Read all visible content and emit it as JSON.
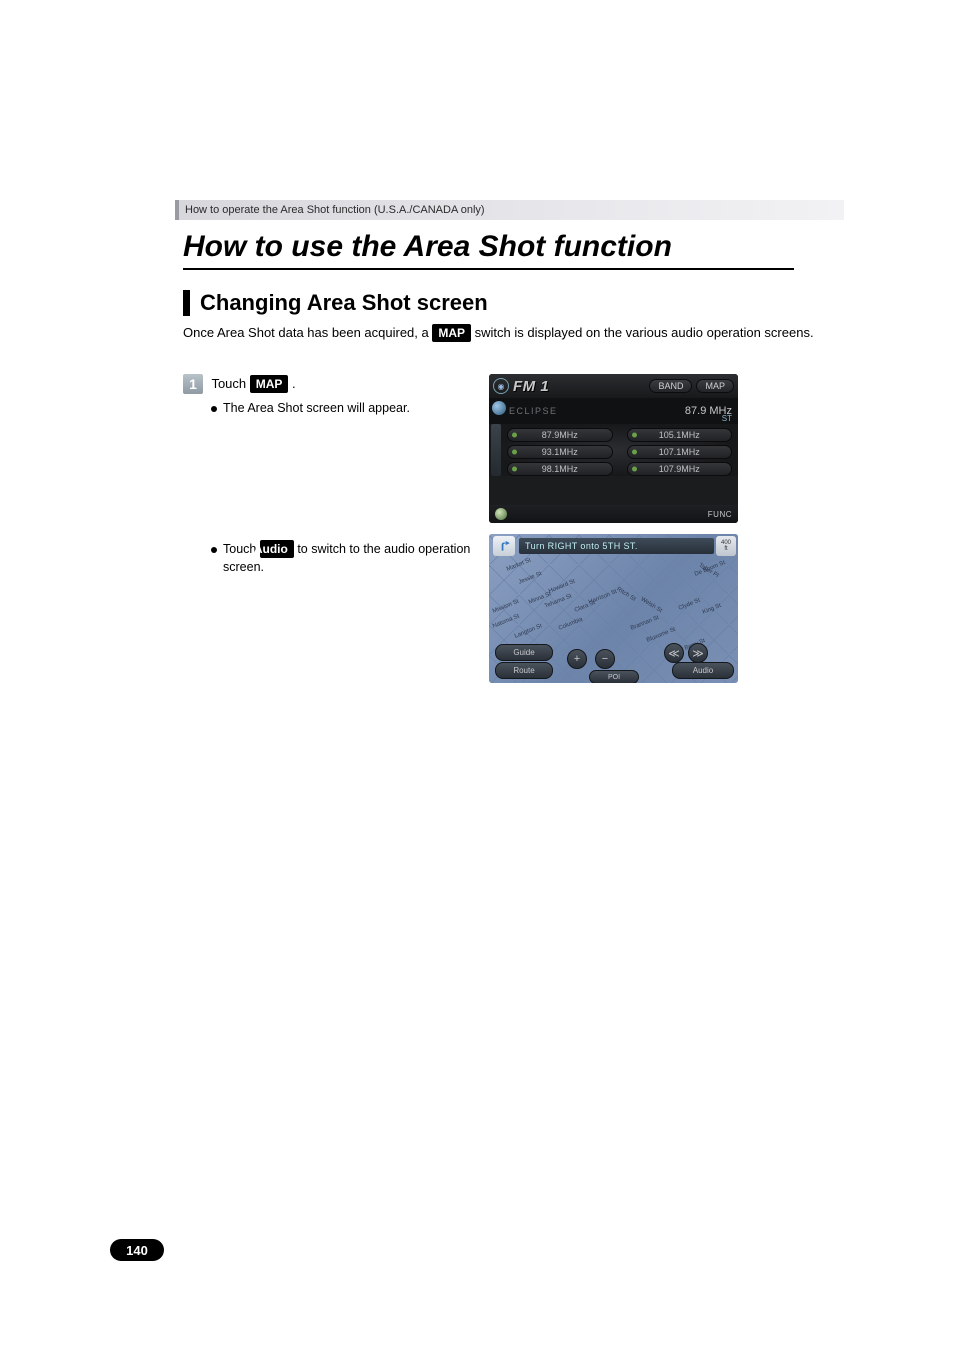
{
  "breadcrumb": "How to operate the Area Shot function (U.S.A./CANADA only)",
  "title": "How to use the Area Shot function",
  "section": "Changing Area Shot screen",
  "intro": {
    "pre": "Once Area Shot data has been acquired, a ",
    "badge": "MAP",
    "post": " switch is displayed on the various audio operation screens."
  },
  "step": {
    "num": "1",
    "pre": "Touch ",
    "badge": "MAP",
    "post": " .",
    "bullet": "The Area Shot screen will appear."
  },
  "second": {
    "pre": "Touch ",
    "badge": "Audio",
    "post": " to switch to the audio operation screen."
  },
  "shot1": {
    "title": "FM 1",
    "band_btn": "BAND",
    "map_btn": "MAP",
    "station": "ECLIPSE",
    "freq": "87.9 MHz",
    "st": "ST",
    "presets": [
      "87.9MHz",
      "105.1MHz",
      "93.1MHz",
      "107.1MHz",
      "98.1MHz",
      "107.9MHz"
    ],
    "func": "FUNC"
  },
  "shot2": {
    "guidance": "Turn RIGHT onto 5TH ST.",
    "dist_val": "400",
    "dist_unit": "ft",
    "streets": {
      "market": "Market St",
      "jessie": "Jessie St",
      "howard": "Howard St",
      "mission": "Mission St",
      "natoma": "Natoma St",
      "clara": "Clara St",
      "tehama": "Tehama St",
      "minna": "Minna St",
      "langton": "Langton St",
      "columbia": "Columbia",
      "harrison": "Harrison St",
      "ritch": "Ritch St",
      "brannan": "Brannan St",
      "bluxome": "Bluxome St",
      "clyde": "Clyde St",
      "king": "King St",
      "berry": "Berry St",
      "deboom": "De Boom St",
      "taber": "Taber Pl",
      "welsh": "Welsh St"
    },
    "btns": {
      "guide": "Guide",
      "route": "Route",
      "poi": "POI",
      "audio": "Audio",
      "plus": "+",
      "minus": "−",
      "prev": "≪",
      "next": "≫"
    }
  },
  "page_number": "140"
}
